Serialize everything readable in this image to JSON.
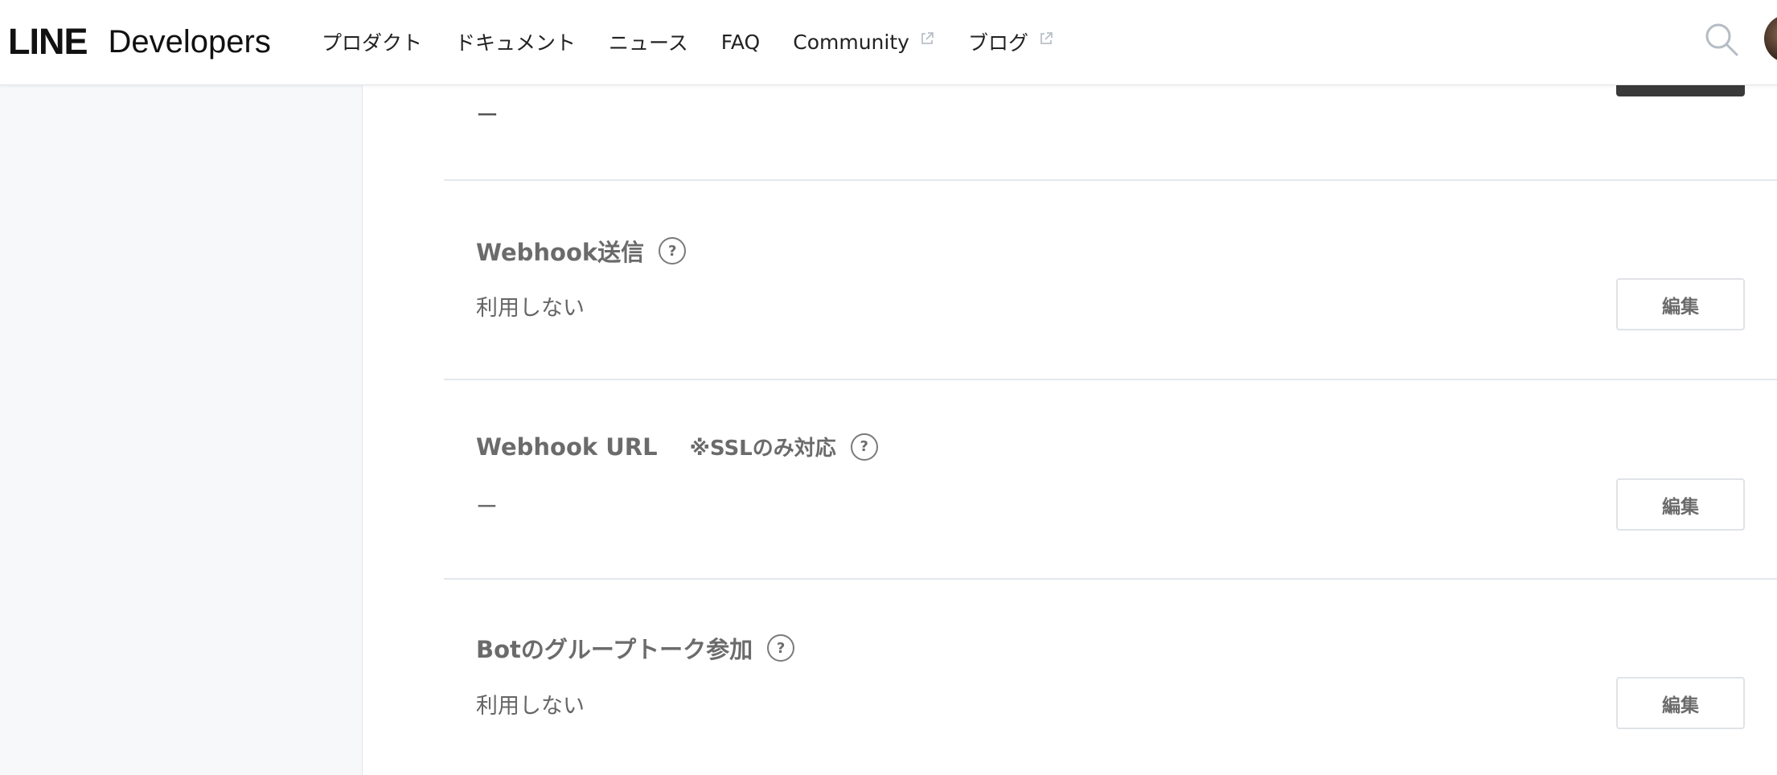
{
  "header": {
    "logo_line": "LINE",
    "logo_developers": "Developers",
    "nav": [
      {
        "label": "プロダクト",
        "external": false
      },
      {
        "label": "ドキュメント",
        "external": false
      },
      {
        "label": "ニュース",
        "external": false
      },
      {
        "label": "FAQ",
        "external": false
      },
      {
        "label": "Community",
        "external": true
      },
      {
        "label": "ブログ",
        "external": true
      }
    ]
  },
  "top_section": {
    "value": "ー"
  },
  "sections": [
    {
      "title": "Webhook送信",
      "note": "",
      "help": "?",
      "value": "利用しない",
      "edit_label": "編集"
    },
    {
      "title": "Webhook URL",
      "note": "※SSLのみ対応",
      "help": "?",
      "value": "ー",
      "edit_label": "編集"
    },
    {
      "title": "Botのグループトーク参加",
      "note": "",
      "help": "?",
      "value": "利用しない",
      "edit_label": "編集"
    }
  ],
  "colors": {
    "accent_text": "#6b6b6b",
    "divider": "#e3e8ee",
    "sidebar_bg": "#f7f8fa"
  }
}
